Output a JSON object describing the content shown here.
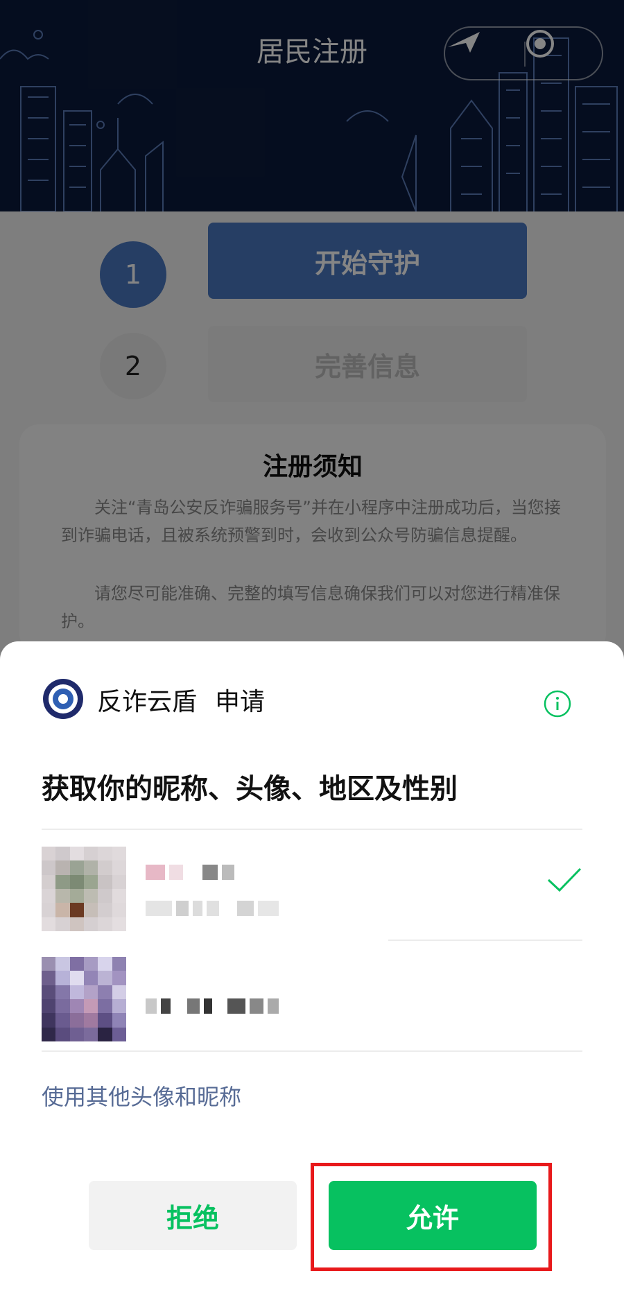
{
  "header": {
    "title": "居民注册",
    "menu_icon": "navigation-arrow-icon",
    "close_icon": "record-circle-icon"
  },
  "steps": [
    {
      "number": "1",
      "label": "开始守护",
      "active": true
    },
    {
      "number": "2",
      "label": "完善信息",
      "active": false
    }
  ],
  "notice": {
    "title": "注册须知",
    "paragraphs": [
      "关注“青岛公安反诈骗服务号”并在小程序中注册成功后，当您接到诈骗电话，且被系统预警到时，会收到公众号防骗信息提醒。",
      "请您尽可能准确、完整的填写信息确保我们可以对您进行精准保护。"
    ]
  },
  "sheet": {
    "app_name": "反诈云盾",
    "request_word": "申请",
    "title": "获取你的昵称、头像、地区及性别",
    "profiles": [
      {
        "selected": true
      },
      {
        "selected": false
      }
    ],
    "other_link": "使用其他头像和昵称",
    "reject_label": "拒绝",
    "allow_label": "允许"
  },
  "colors": {
    "accent_green": "#07c160",
    "step_blue": "#4a78c0",
    "highlight_red": "#e8191b",
    "link_blue": "#576b95"
  }
}
